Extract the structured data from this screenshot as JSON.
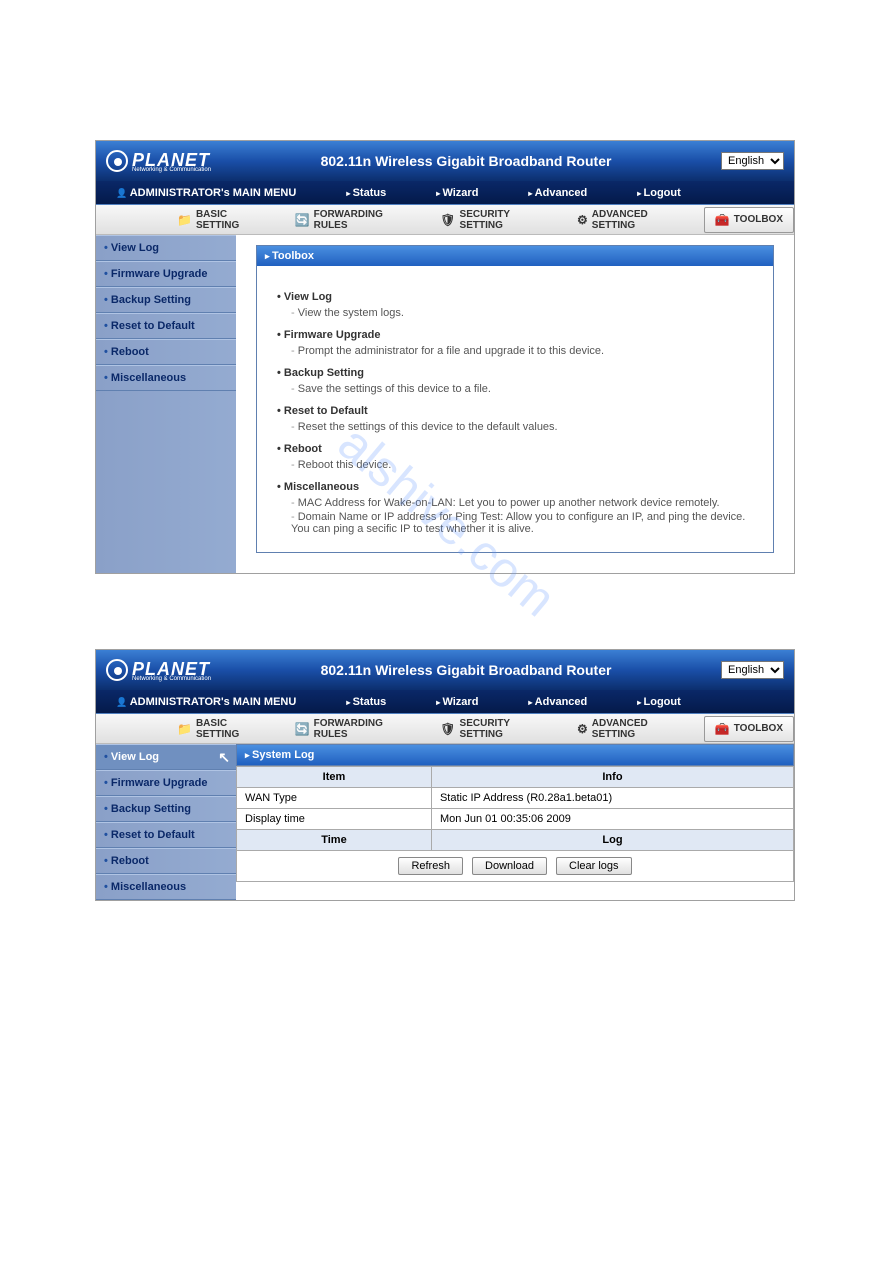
{
  "watermark": "alshive.com",
  "header": {
    "logo_name": "PLANET",
    "logo_sub": "Networking & Communication",
    "title": "802.11n Wireless Gigabit Broadband Router",
    "lang": "English"
  },
  "menu": {
    "admin": "ADMINISTRATOR's MAIN MENU",
    "status": "Status",
    "wizard": "Wizard",
    "advanced": "Advanced",
    "logout": "Logout"
  },
  "tabs": {
    "basic": "BASIC SETTING",
    "forwarding": "FORWARDING RULES",
    "security": "SECURITY SETTING",
    "advanced": "ADVANCED SETTING",
    "toolbox": "TOOLBOX"
  },
  "sidebar": {
    "view_log": "View Log",
    "firmware": "Firmware Upgrade",
    "backup": "Backup Setting",
    "reset": "Reset to Default",
    "reboot": "Reboot",
    "misc": "Miscellaneous"
  },
  "panel1": {
    "title": "Toolbox",
    "items": [
      {
        "title": "View Log",
        "desc": [
          "View the system logs."
        ]
      },
      {
        "title": "Firmware Upgrade",
        "desc": [
          "Prompt the administrator for a file and upgrade it to this device."
        ]
      },
      {
        "title": "Backup Setting",
        "desc": [
          "Save the settings of this device to a file."
        ]
      },
      {
        "title": "Reset to Default",
        "desc": [
          "Reset the settings of this device to the default values."
        ]
      },
      {
        "title": "Reboot",
        "desc": [
          "Reboot this device."
        ]
      },
      {
        "title": "Miscellaneous",
        "desc": [
          "MAC Address for Wake-on-LAN: Let you to power up another network device remotely.",
          "Domain Name or IP address for Ping Test: Allow you to configure an IP, and ping the device. You can ping a secific IP to test whether it is alive."
        ]
      }
    ]
  },
  "panel2": {
    "title": "System Log",
    "th_item": "Item",
    "th_info": "Info",
    "th_time": "Time",
    "th_log": "Log",
    "row1_item": "WAN Type",
    "row1_info": "Static IP Address (R0.28a1.beta01)",
    "row2_item": "Display time",
    "row2_info": "Mon Jun 01 00:35:06 2009",
    "btn_refresh": "Refresh",
    "btn_download": "Download",
    "btn_clear": "Clear logs"
  }
}
